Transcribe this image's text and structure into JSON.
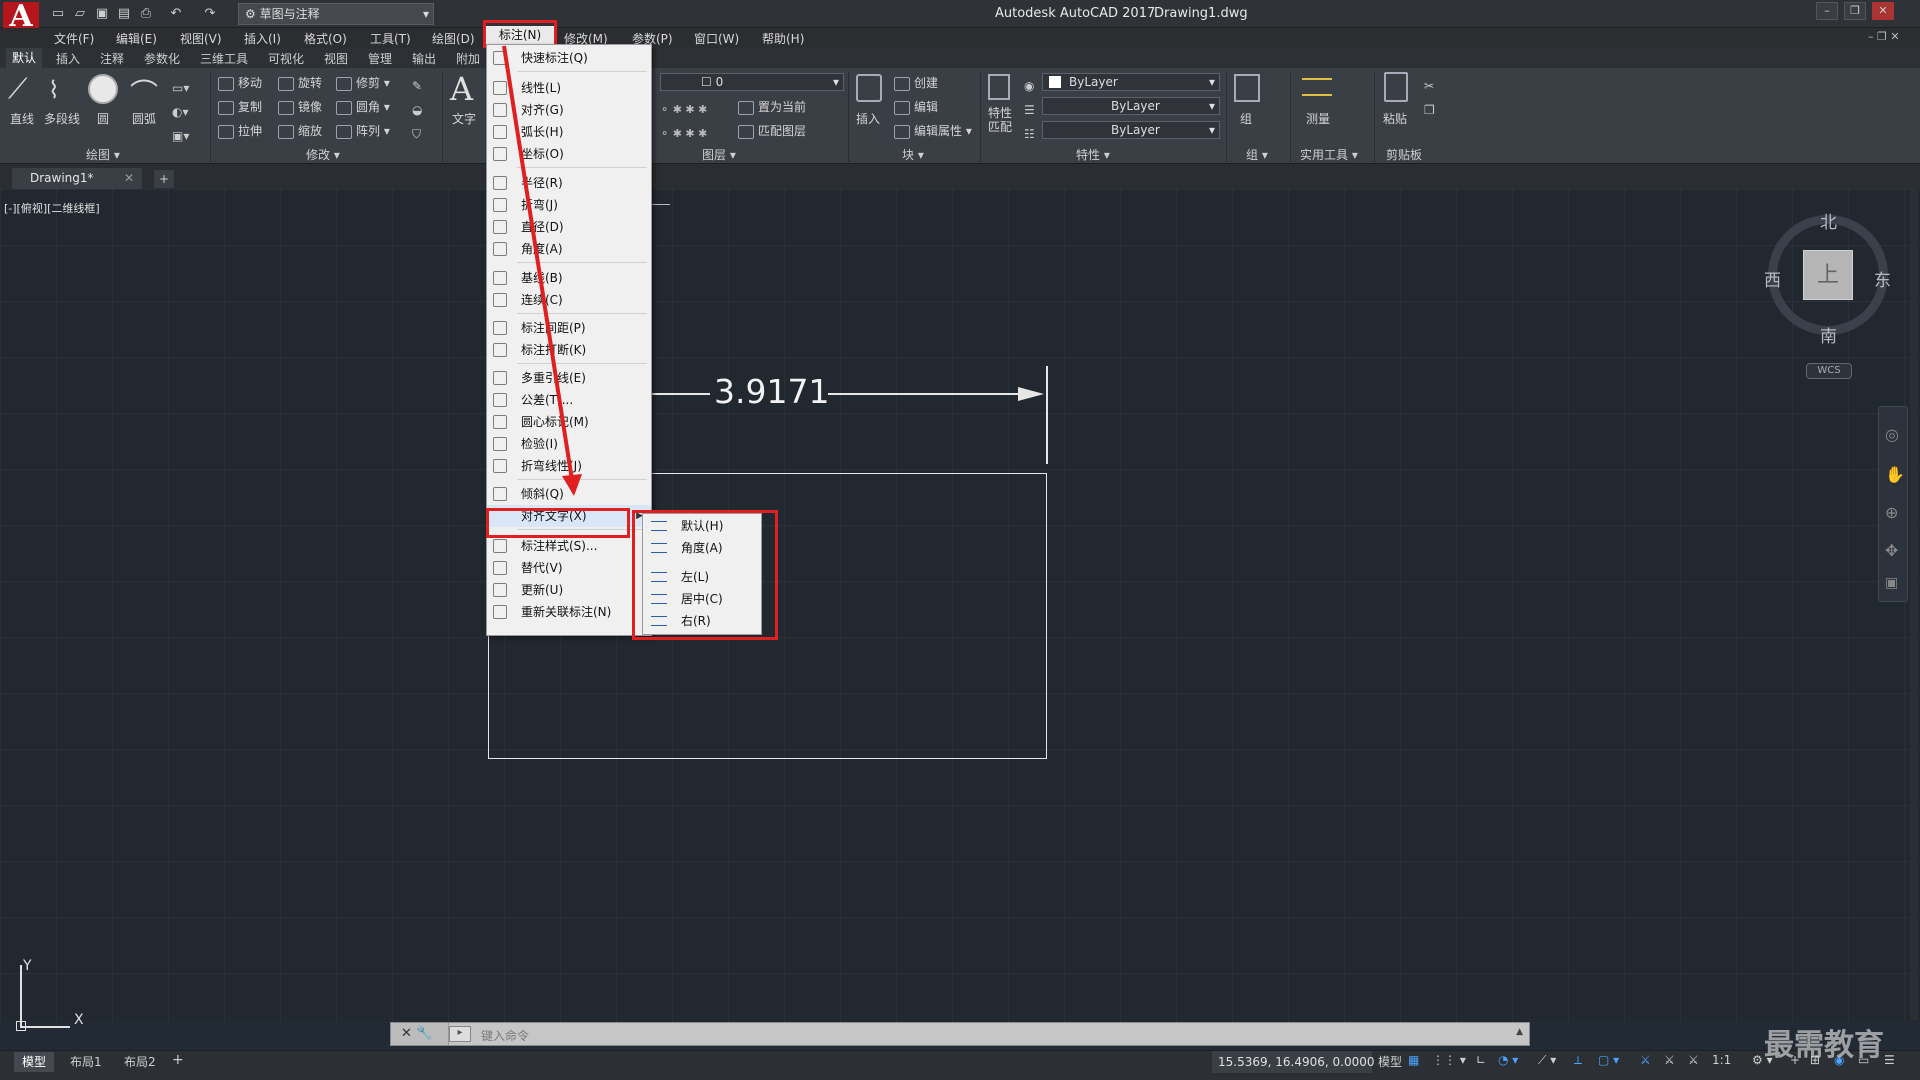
{
  "titlebar": {
    "app_title": "Autodesk AutoCAD 2017",
    "doc_title": "Drawing1.dwg",
    "workspace": "草图与注释"
  },
  "menubar": {
    "items": [
      "文件(F)",
      "编辑(E)",
      "视图(V)",
      "插入(I)",
      "格式(O)",
      "工具(T)",
      "绘图(D)",
      "标注(N)",
      "修改(M)",
      "参数(P)",
      "窗口(W)",
      "帮助(H)"
    ]
  },
  "ribbon_tabs": [
    "默认",
    "插入",
    "注释",
    "参数化",
    "三维工具",
    "可视化",
    "视图",
    "管理",
    "输出",
    "附加"
  ],
  "draw_panel": {
    "tools": [
      "直线",
      "多段线",
      "圆",
      "圆弧"
    ],
    "label": "绘图"
  },
  "modify_panel": {
    "tools": [
      "移动",
      "旋转",
      "修剪",
      "复制",
      "镜像",
      "圆角",
      "拉伸",
      "缩放",
      "阵列"
    ],
    "label": "修改"
  },
  "annot_panel": {
    "tool": "文字"
  },
  "layer_panel": {
    "current_layer": "0",
    "tools": [
      "置为当前",
      "匹配图层"
    ],
    "label": "图层"
  },
  "block_panel": {
    "tools": [
      "插入",
      "创建",
      "编辑",
      "编辑属性"
    ],
    "label": "块"
  },
  "properties_panel": {
    "color": "ByLayer",
    "linetype": "ByLayer",
    "lineweight": "ByLayer",
    "match": "特性匹配",
    "label": "特性"
  },
  "group_panel": {
    "label": "组",
    "tool": "组"
  },
  "utilities_panel": {
    "label": "实用工具",
    "tool": "测量"
  },
  "clipboard_panel": {
    "label": "剪贴板",
    "tool": "粘贴"
  },
  "doc_tab": {
    "name": "Drawing1*"
  },
  "viewport_label": "[-][俯视][二维线框]",
  "dimension": {
    "value": "3.9171"
  },
  "dim_menu": {
    "items": [
      "快速标注(Q)",
      "线性(L)",
      "对齐(G)",
      "弧长(H)",
      "坐标(O)",
      "半径(R)",
      "折弯(J)",
      "直径(D)",
      "角度(A)",
      "基线(B)",
      "连续(C)",
      "标注间距(P)",
      "标注打断(K)",
      "多重引线(E)",
      "公差(T)...",
      "圆心标记(M)",
      "检验(I)",
      "折弯线性(J)",
      "倾斜(Q)",
      "对齐文字(X)",
      "标注样式(S)...",
      "替代(V)",
      "更新(U)",
      "重新关联标注(N)"
    ]
  },
  "align_text_submenu": {
    "items": [
      "默认(H)",
      "角度(A)",
      "左(L)",
      "居中(C)",
      "右(R)"
    ]
  },
  "compass": {
    "north": "北",
    "south": "南",
    "east": "东",
    "west": "西",
    "top": "上",
    "wcs": "WCS"
  },
  "command": {
    "placeholder": "键入命令"
  },
  "layout_tabs": [
    "模型",
    "布局1",
    "布局2"
  ],
  "status": {
    "coords": "15.5369, 16.4906, 0.0000",
    "model": "模型",
    "scale": "1:1"
  },
  "watermark": "最需教育"
}
